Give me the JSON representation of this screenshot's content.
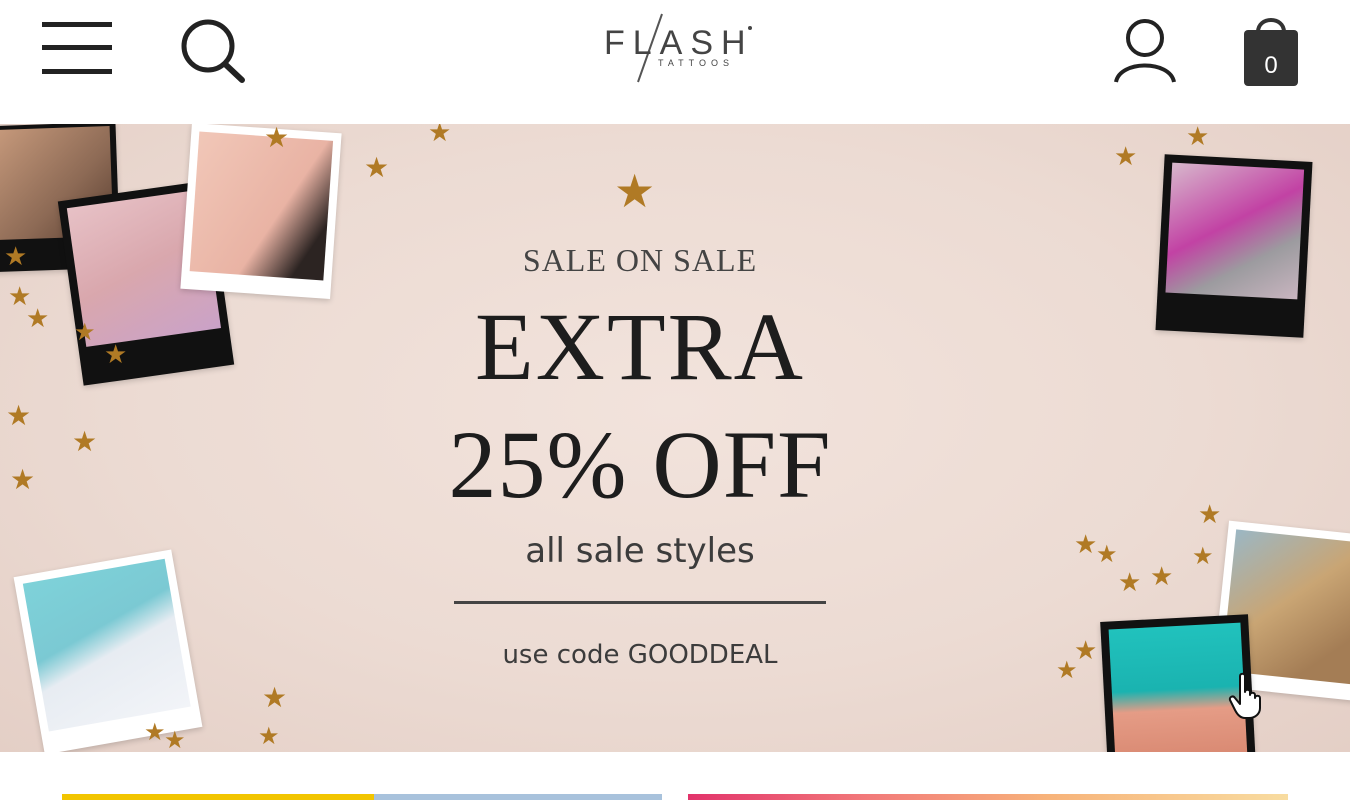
{
  "header": {
    "menu_icon": "hamburger-menu-icon",
    "search_icon": "search-icon",
    "logo_text": "FLASH",
    "logo_subtext": "TATTOOS",
    "account_icon": "user-icon",
    "cart_icon": "shopping-bag-icon",
    "cart_count": "0"
  },
  "banner": {
    "eyebrow": "SALE ON SALE",
    "headline_line1": "EXTRA",
    "headline_line2": "25% OFF",
    "subline": "all sale styles",
    "code_line": "use code GOODDEAL",
    "star_color": "#b07a25",
    "background_color": "#ecdbd3"
  },
  "cards": {
    "left_colors": [
      "#f2c500",
      "#a8c2dc"
    ],
    "right_colors": [
      "#e2336b",
      "#f8dca0"
    ]
  }
}
